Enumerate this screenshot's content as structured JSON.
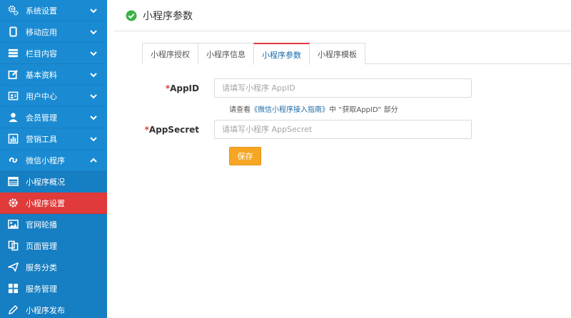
{
  "sidebar": {
    "items": [
      {
        "label": "系统设置",
        "icon": "gears-icon"
      },
      {
        "label": "移动应用",
        "icon": "mobile-icon"
      },
      {
        "label": "栏目内容",
        "icon": "list-icon"
      },
      {
        "label": "基本资料",
        "icon": "edit-icon"
      },
      {
        "label": "用户中心",
        "icon": "user-card-icon"
      },
      {
        "label": "会员管理",
        "icon": "user-icon"
      },
      {
        "label": "营销工具",
        "icon": "bar-chart-icon"
      },
      {
        "label": "微信小程序",
        "icon": "mini-program-icon"
      }
    ],
    "sub_items": [
      {
        "label": "小程序概况",
        "icon": "table-icon"
      },
      {
        "label": "小程序设置",
        "icon": "gear-icon"
      },
      {
        "label": "官网轮播",
        "icon": "image-icon"
      },
      {
        "label": "页面管理",
        "icon": "copy-icon"
      },
      {
        "label": "服务分类",
        "icon": "send-icon"
      },
      {
        "label": "服务管理",
        "icon": "grid-icon"
      },
      {
        "label": "小程序发布",
        "icon": "pencil-icon"
      }
    ]
  },
  "header": {
    "title": "小程序参数"
  },
  "tabs": [
    "小程序授权",
    "小程序信息",
    "小程序参数",
    "小程序模板"
  ],
  "form": {
    "appid": {
      "star": "*",
      "label": "AppID",
      "placeholder": "请填写小程序 AppID"
    },
    "help": {
      "prefix": "请查看",
      "link": "《微信小程序接入指南》",
      "suffix": "中 “获取AppID” 部分"
    },
    "appsecret": {
      "star": "*",
      "label": "AppSecret",
      "placeholder": "请填写小程序 AppSecret"
    },
    "save_label": "保存"
  },
  "colors": {
    "sidebar": "#1a8bd2",
    "active": "#e03a3a",
    "save": "#f6a623",
    "check": "#3cb14a"
  }
}
